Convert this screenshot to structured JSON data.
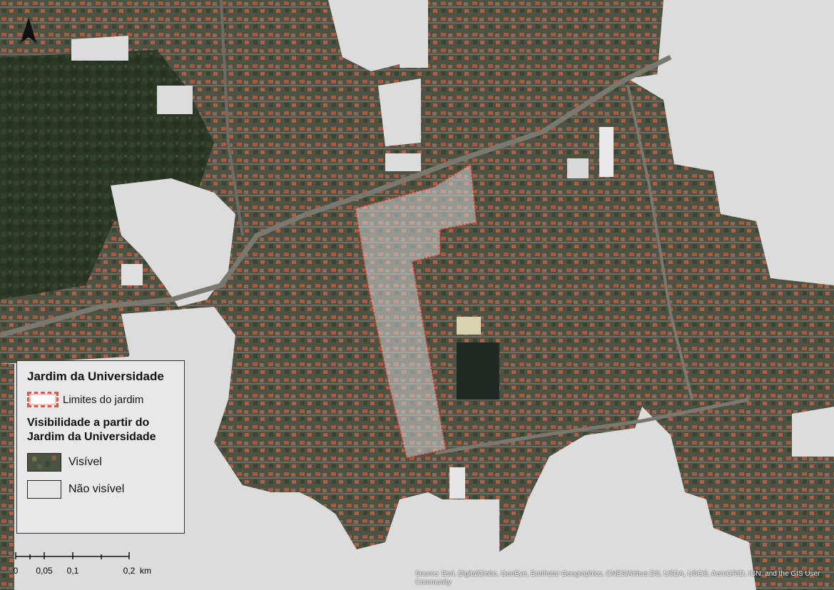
{
  "legend": {
    "title": "Jardim da Universidade",
    "limits_label": "Limites do jardim",
    "visibility_title": "Visibilidade a partir do Jardim da Universidade",
    "visible_label": "Visível",
    "not_visible_label": "Não visível"
  },
  "scale": {
    "labels": [
      "0",
      "0,05",
      "0,1",
      "0,2"
    ],
    "unit": "km"
  },
  "source_text": "Source: Esri, DigitalGlobe, GeoEye, Earthstar Geographics, CNES/Airbus DS, USDA, USGS, AeroGRID, IGN, and the GIS User Community",
  "colors": {
    "not_visible": "#dcdcdc",
    "garden_outline": "#c0392b",
    "vegetation": "#2f3a27",
    "roofs": "#b5533a"
  }
}
